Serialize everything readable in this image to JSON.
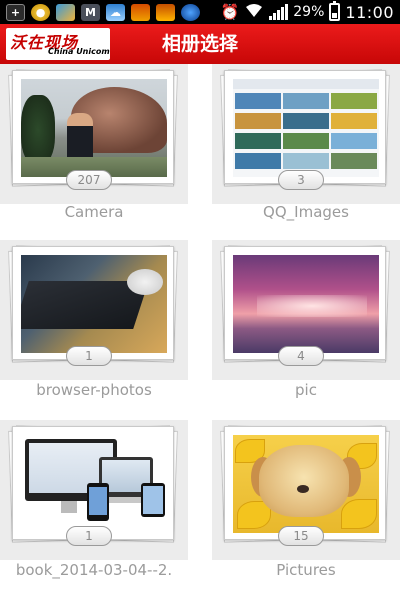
{
  "status_bar": {
    "icons": [
      "plus-icon",
      "coin-icon",
      "browser-icon",
      "mail-icon",
      "weather-icon",
      "app-icon",
      "app-icon",
      "globe-icon"
    ],
    "alarm_icon": "alarm-icon",
    "wifi_icon": "wifi-icon",
    "signal_icon": "signal-icon",
    "battery_percent": "29%",
    "time": "11:00"
  },
  "header": {
    "logo_main": "沃在现场",
    "logo_sub": "China Unicom",
    "title": "相册选择",
    "bg_color": "#e00f0f"
  },
  "albums": [
    {
      "name": "Camera",
      "count": "207"
    },
    {
      "name": "QQ_Images",
      "count": "3"
    },
    {
      "name": "browser-photos",
      "count": "1"
    },
    {
      "name": "pic",
      "count": "4"
    },
    {
      "name": "book_2014-03-04--2.",
      "count": "1"
    },
    {
      "name": "Pictures",
      "count": "15"
    }
  ]
}
